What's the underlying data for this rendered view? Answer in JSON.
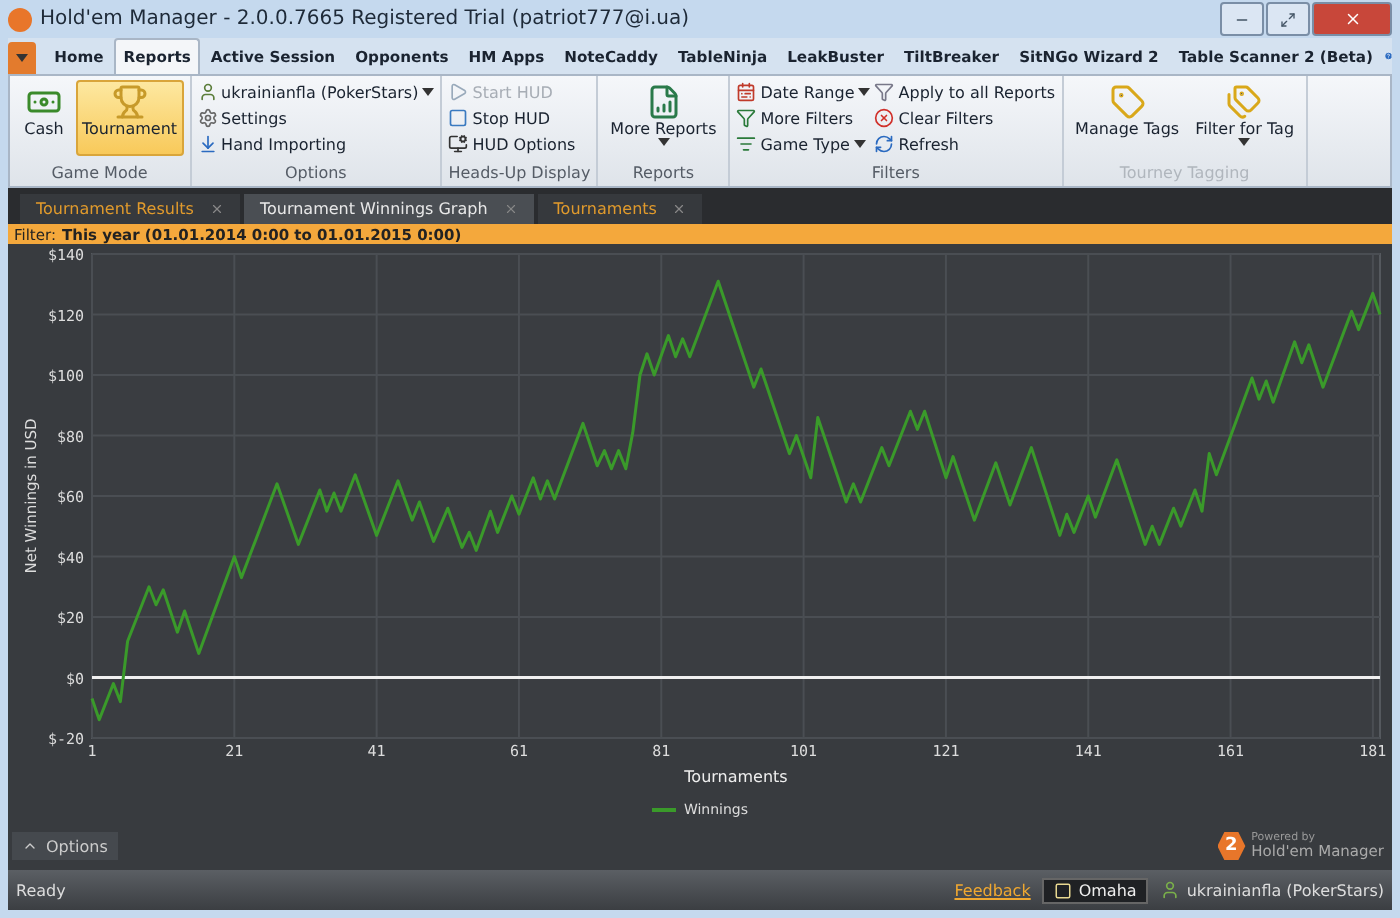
{
  "window": {
    "title": "Hold'em Manager - 2.0.0.7665 Registered Trial (patriot777@i.ua)"
  },
  "menu_tabs": [
    {
      "label": "Home",
      "selected": false
    },
    {
      "label": "Reports",
      "selected": true
    },
    {
      "label": "Active Session",
      "selected": false
    },
    {
      "label": "Opponents",
      "selected": false
    },
    {
      "label": "HM Apps",
      "selected": false
    },
    {
      "label": "NoteCaddy",
      "selected": false
    },
    {
      "label": "TableNinja",
      "selected": false
    },
    {
      "label": "LeakBuster",
      "selected": false
    },
    {
      "label": "TiltBreaker",
      "selected": false
    },
    {
      "label": "SitNGo Wizard 2",
      "selected": false
    },
    {
      "label": "Table Scanner 2 (Beta)",
      "selected": false
    }
  ],
  "ribbon": {
    "groups": [
      {
        "label": "Game Mode",
        "disabled": false,
        "items": [
          {
            "kind": "large",
            "label": "Cash",
            "selected": false,
            "disabled": false,
            "dropdown": false
          },
          {
            "kind": "large",
            "label": "Tournament",
            "selected": true,
            "disabled": false,
            "dropdown": false
          }
        ]
      },
      {
        "label": "Options",
        "disabled": false,
        "items": [
          {
            "kind": "small",
            "label": "ukrainianfla (PokerStars)",
            "selected": false,
            "disabled": false,
            "dropdown": true
          },
          {
            "kind": "small",
            "label": "Settings",
            "selected": false,
            "disabled": false,
            "dropdown": false
          },
          {
            "kind": "small",
            "label": "Hand Importing",
            "selected": false,
            "disabled": false,
            "dropdown": false
          }
        ]
      },
      {
        "label": "Heads-Up Display",
        "disabled": false,
        "items": [
          {
            "kind": "small",
            "label": "Start HUD",
            "selected": false,
            "disabled": true,
            "dropdown": false
          },
          {
            "kind": "small",
            "label": "Stop HUD",
            "selected": false,
            "disabled": false,
            "dropdown": false
          },
          {
            "kind": "small",
            "label": "HUD Options",
            "selected": false,
            "disabled": false,
            "dropdown": false
          }
        ]
      },
      {
        "label": "Reports",
        "disabled": false,
        "items": [
          {
            "kind": "large",
            "label": "More Reports",
            "selected": false,
            "disabled": false,
            "dropdown": true
          }
        ]
      },
      {
        "label": "Filters",
        "disabled": false,
        "items": [
          {
            "kind": "small",
            "label": "Date Range",
            "selected": false,
            "disabled": false,
            "dropdown": true
          },
          {
            "kind": "small",
            "label": "More Filters",
            "selected": false,
            "disabled": false,
            "dropdown": false
          },
          {
            "kind": "small",
            "label": "Game Type",
            "selected": false,
            "disabled": false,
            "dropdown": true
          },
          {
            "kind": "small",
            "label": "Apply to all Reports",
            "selected": false,
            "disabled": false,
            "dropdown": false
          },
          {
            "kind": "small",
            "label": "Clear Filters",
            "selected": false,
            "disabled": false,
            "dropdown": false
          },
          {
            "kind": "small",
            "label": "Refresh",
            "selected": false,
            "disabled": false,
            "dropdown": false
          }
        ]
      },
      {
        "label": "Tourney Tagging",
        "disabled": true,
        "items": [
          {
            "kind": "large",
            "label": "Manage Tags",
            "selected": false,
            "disabled": false,
            "dropdown": false
          },
          {
            "kind": "large",
            "label": "Filter for Tag",
            "selected": false,
            "disabled": false,
            "dropdown": true
          }
        ]
      }
    ]
  },
  "doc_tabs": [
    {
      "label": "Tournament Results",
      "selected": false
    },
    {
      "label": "Tournament Winnings Graph",
      "selected": true
    },
    {
      "label": "Tournaments",
      "selected": false
    }
  ],
  "filter_bar": {
    "label": "Filter:",
    "value": "This year (01.01.2014 0:00 to 01.01.2015 0:00)"
  },
  "chart": {
    "chart_data": {
      "type": "line",
      "xlabel": "Tournaments",
      "ylabel": "Net Winnings in USD",
      "x": [
        1,
        2,
        4,
        5,
        6,
        9,
        10,
        11,
        13,
        14,
        16,
        21,
        22,
        27,
        30,
        33,
        34,
        35,
        36,
        38,
        41,
        44,
        46,
        47,
        49,
        51,
        53,
        54,
        55,
        57,
        58,
        60,
        61,
        63,
        64,
        65,
        66,
        70,
        72,
        73,
        74,
        75,
        76,
        77,
        78,
        79,
        80,
        82,
        83,
        84,
        85,
        89,
        94,
        95,
        99,
        100,
        102,
        103,
        107,
        108,
        109,
        112,
        113,
        116,
        117,
        118,
        121,
        122,
        125,
        128,
        130,
        133,
        137,
        138,
        139,
        141,
        142,
        145,
        149,
        150,
        151,
        153,
        154,
        156,
        157,
        158,
        159,
        164,
        165,
        166,
        167,
        170,
        171,
        172,
        174,
        178,
        179,
        181,
        182
      ],
      "series": [
        {
          "name": "Winnings",
          "color": "#3a9a2a",
          "values": [
            -7,
            -14,
            -2,
            -8,
            12,
            30,
            24,
            29,
            15,
            22,
            8,
            40,
            33,
            64,
            44,
            62,
            55,
            61,
            55,
            67,
            47,
            65,
            52,
            58,
            45,
            56,
            43,
            48,
            42,
            55,
            48,
            60,
            54,
            66,
            59,
            65,
            59,
            84,
            70,
            75,
            69,
            75,
            69,
            81,
            100,
            107,
            100,
            113,
            106,
            112,
            106,
            131,
            96,
            102,
            74,
            80,
            66,
            86,
            58,
            64,
            58,
            76,
            70,
            88,
            82,
            88,
            66,
            73,
            52,
            71,
            57,
            76,
            47,
            54,
            48,
            60,
            53,
            72,
            44,
            50,
            44,
            56,
            50,
            62,
            55,
            74,
            67,
            99,
            92,
            98,
            91,
            111,
            104,
            110,
            96,
            121,
            115,
            127,
            120
          ]
        }
      ],
      "grid": true,
      "xlim": [
        1,
        182
      ],
      "ylim": [
        -20,
        140
      ],
      "xticks": [
        1,
        21,
        41,
        61,
        81,
        101,
        121,
        141,
        161,
        181
      ],
      "yticks": [
        {
          "value": -20,
          "label": "$-20"
        },
        {
          "value": 0,
          "label": "$0"
        },
        {
          "value": 20,
          "label": "$20"
        },
        {
          "value": 40,
          "label": "$40"
        },
        {
          "value": 60,
          "label": "$60"
        },
        {
          "value": 80,
          "label": "$80"
        },
        {
          "value": 100,
          "label": "$100"
        },
        {
          "value": 120,
          "label": "$120"
        },
        {
          "value": 140,
          "label": "$140"
        }
      ]
    }
  },
  "options_toggle": {
    "label": "Options",
    "expanded": false
  },
  "branding": {
    "badge": "2",
    "powered_by": "Powered by",
    "product": "Hold'em Manager"
  },
  "status_bar": {
    "text": "Ready",
    "link": "Feedback",
    "game_button": "Omaha",
    "account": "ukrainianfla (PokerStars)"
  }
}
